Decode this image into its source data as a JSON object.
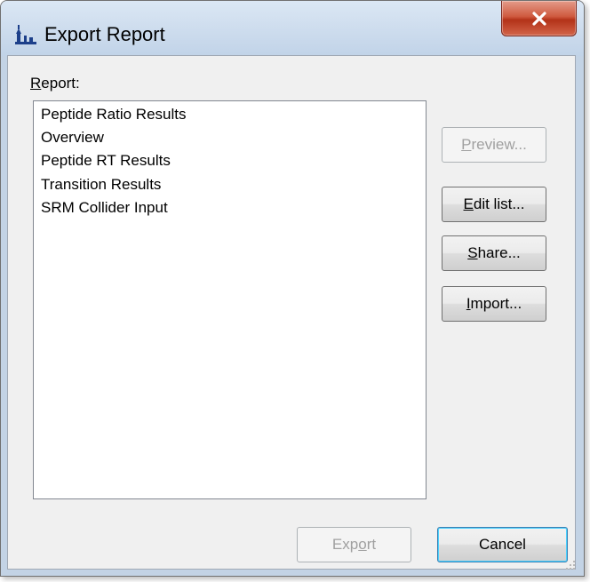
{
  "window": {
    "title": "Export Report"
  },
  "report_list": {
    "label_accel": "R",
    "label_rest": "eport:",
    "items": [
      "Peptide Ratio Results",
      "Overview",
      "Peptide RT Results",
      "Transition Results",
      "SRM Collider Input"
    ]
  },
  "buttons": {
    "preview": {
      "accel": "P",
      "rest": "review...",
      "enabled": false
    },
    "edit_list": {
      "accel": "E",
      "rest": "dit list...",
      "enabled": true
    },
    "share": {
      "accel": "S",
      "rest": "hare...",
      "enabled": true
    },
    "import": {
      "accel": "I",
      "rest": "mport...",
      "enabled": true
    },
    "export": {
      "pre": "Exp",
      "accel": "o",
      "rest": "rt",
      "enabled": false
    },
    "cancel": {
      "label": "Cancel",
      "enabled": true
    }
  },
  "colors": {
    "title_bar": "#c1d3e8",
    "client_bg": "#f0f0f0",
    "close_button": "#c44a2f",
    "disabled_text": "#a0a0a0"
  },
  "icons": [
    "app-chart-icon",
    "close-icon",
    "resize-grip-icon"
  ]
}
